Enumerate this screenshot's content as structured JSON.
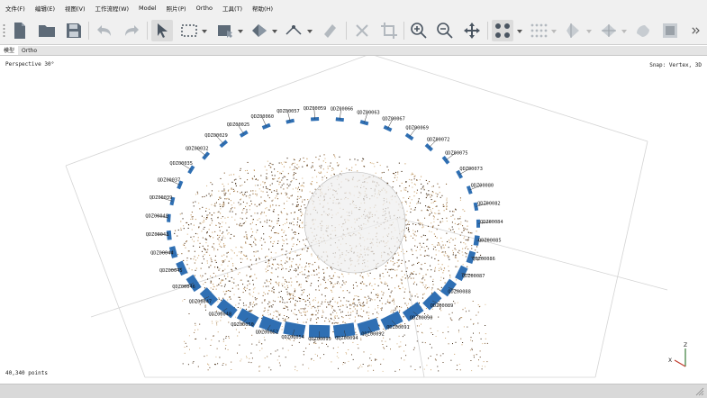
{
  "menubar": {
    "items": [
      "文件(F)",
      "编辑(E)",
      "视图(V)",
      "工作流程(W)",
      "Model",
      "照片(P)",
      "Ortho",
      "工具(T)",
      "帮助(H)"
    ]
  },
  "toolbar": {
    "buttons": [
      {
        "name": "new-project-button",
        "icon": "document-icon"
      },
      {
        "name": "open-project-button",
        "icon": "folder-icon"
      },
      {
        "name": "save-project-button",
        "icon": "floppy-icon"
      },
      {
        "name": "undo-button",
        "icon": "undo-icon"
      },
      {
        "name": "redo-button",
        "icon": "redo-icon"
      },
      {
        "name": "navigation-tool-button",
        "icon": "cursor-icon",
        "active": true
      },
      {
        "name": "rectangle-selection-button",
        "icon": "selection-rect-icon"
      },
      {
        "name": "shape-draw-button",
        "icon": "shape-icon"
      },
      {
        "name": "polygon-tool-button",
        "icon": "polygon-icon"
      },
      {
        "name": "ruler-tool-button",
        "icon": "ruler-icon"
      },
      {
        "name": "eraser-tool-button",
        "icon": "eraser-icon"
      },
      {
        "name": "delete-selection-button",
        "icon": "cross-icon"
      },
      {
        "name": "crop-selection-button",
        "icon": "crop-icon"
      },
      {
        "name": "zoom-in-button",
        "icon": "zoom-in-icon"
      },
      {
        "name": "zoom-out-button",
        "icon": "zoom-out-icon"
      },
      {
        "name": "reset-view-button",
        "icon": "move-arrows-icon"
      },
      {
        "name": "point-cloud-view-button",
        "icon": "points-icon"
      },
      {
        "name": "dense-cloud-view-button",
        "icon": "dense-points-icon"
      },
      {
        "name": "mesh-view-button",
        "icon": "mesh-icon"
      },
      {
        "name": "textured-view-button",
        "icon": "textured-icon"
      },
      {
        "name": "tiled-model-button",
        "icon": "tiled-icon"
      },
      {
        "name": "dem-view-button",
        "icon": "image-icon"
      },
      {
        "name": "toolbar-overflow-button",
        "icon": "chevron-right-icon"
      }
    ]
  },
  "tabs": [
    {
      "label": "模型",
      "active": true
    },
    {
      "label": "Ortho",
      "active": false
    }
  ],
  "viewport": {
    "projection": "Perspective 30°",
    "snap": "Snap: Vertex, 3D",
    "point_count": "40,340 points",
    "axis_z": "Z",
    "axis_x": "X",
    "colors": {
      "camera": "#2f6fb3",
      "cloud_light": "#c9a06a",
      "cloud_dark": "#5a3b1e"
    },
    "camera_labels": [
      "QDZ00060",
      "QDZ00057",
      "QDZ00059",
      "QDZ00066",
      "QDZ00063",
      "QDZ00067",
      "QDZ00069",
      "QDZ00072",
      "QDZ00075",
      "QDZ00073",
      "QDZ00080",
      "QDZ00082",
      "QDZ00084",
      "QDZ00085",
      "QDZ00086",
      "QDZ00087",
      "QDZ00088",
      "QDZ00089",
      "QDZ00090",
      "QDZ00091",
      "QDZ00092",
      "QDZ00094",
      "QDZ00095",
      "QDZ00054",
      "QDZ00052",
      "QDZ00050",
      "QDZ00048",
      "QDZ00047",
      "QDZ00046",
      "QDZ00045",
      "QDZ00044",
      "QDZ00043",
      "QDZ00040",
      "QDZ00039",
      "QDZ00037",
      "QDZ00035",
      "QDZ00032",
      "QDZ00029",
      "QDZ00025"
    ]
  }
}
